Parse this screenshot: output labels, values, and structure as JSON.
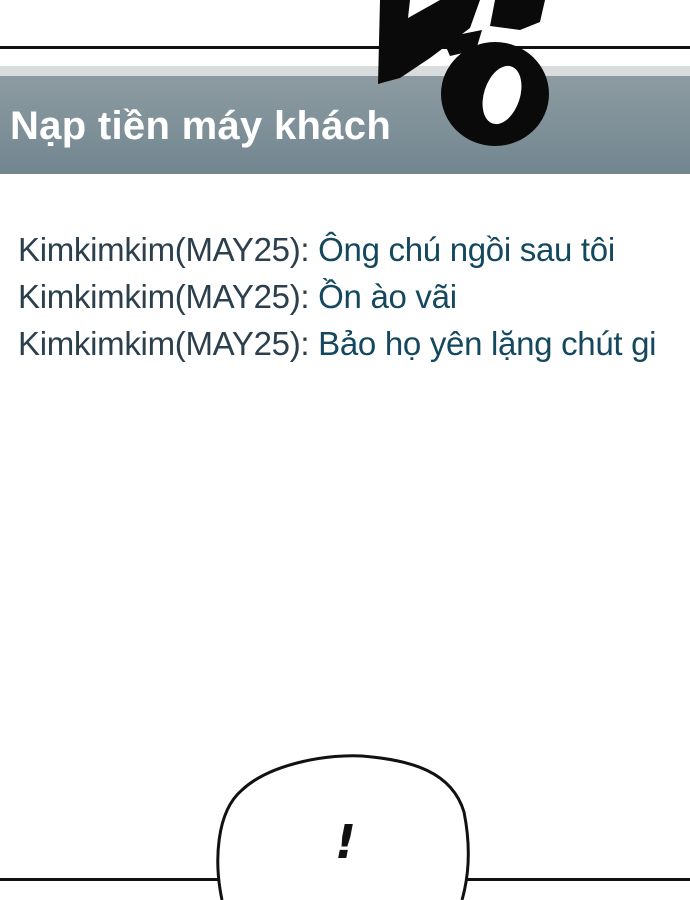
{
  "header": {
    "title": "Nạp tiền máy khách"
  },
  "chat": {
    "messages": [
      {
        "user": "Kimkimkim(MAY25):",
        "text": "Ông chú ngồi sau tôi"
      },
      {
        "user": "Kimkimkim(MAY25):",
        "text": "Ồn ào vãi"
      },
      {
        "user": "Kimkimkim(MAY25):",
        "text": "Bảo họ yên lặng chút gi"
      }
    ]
  },
  "bubble": {
    "text": "!"
  }
}
